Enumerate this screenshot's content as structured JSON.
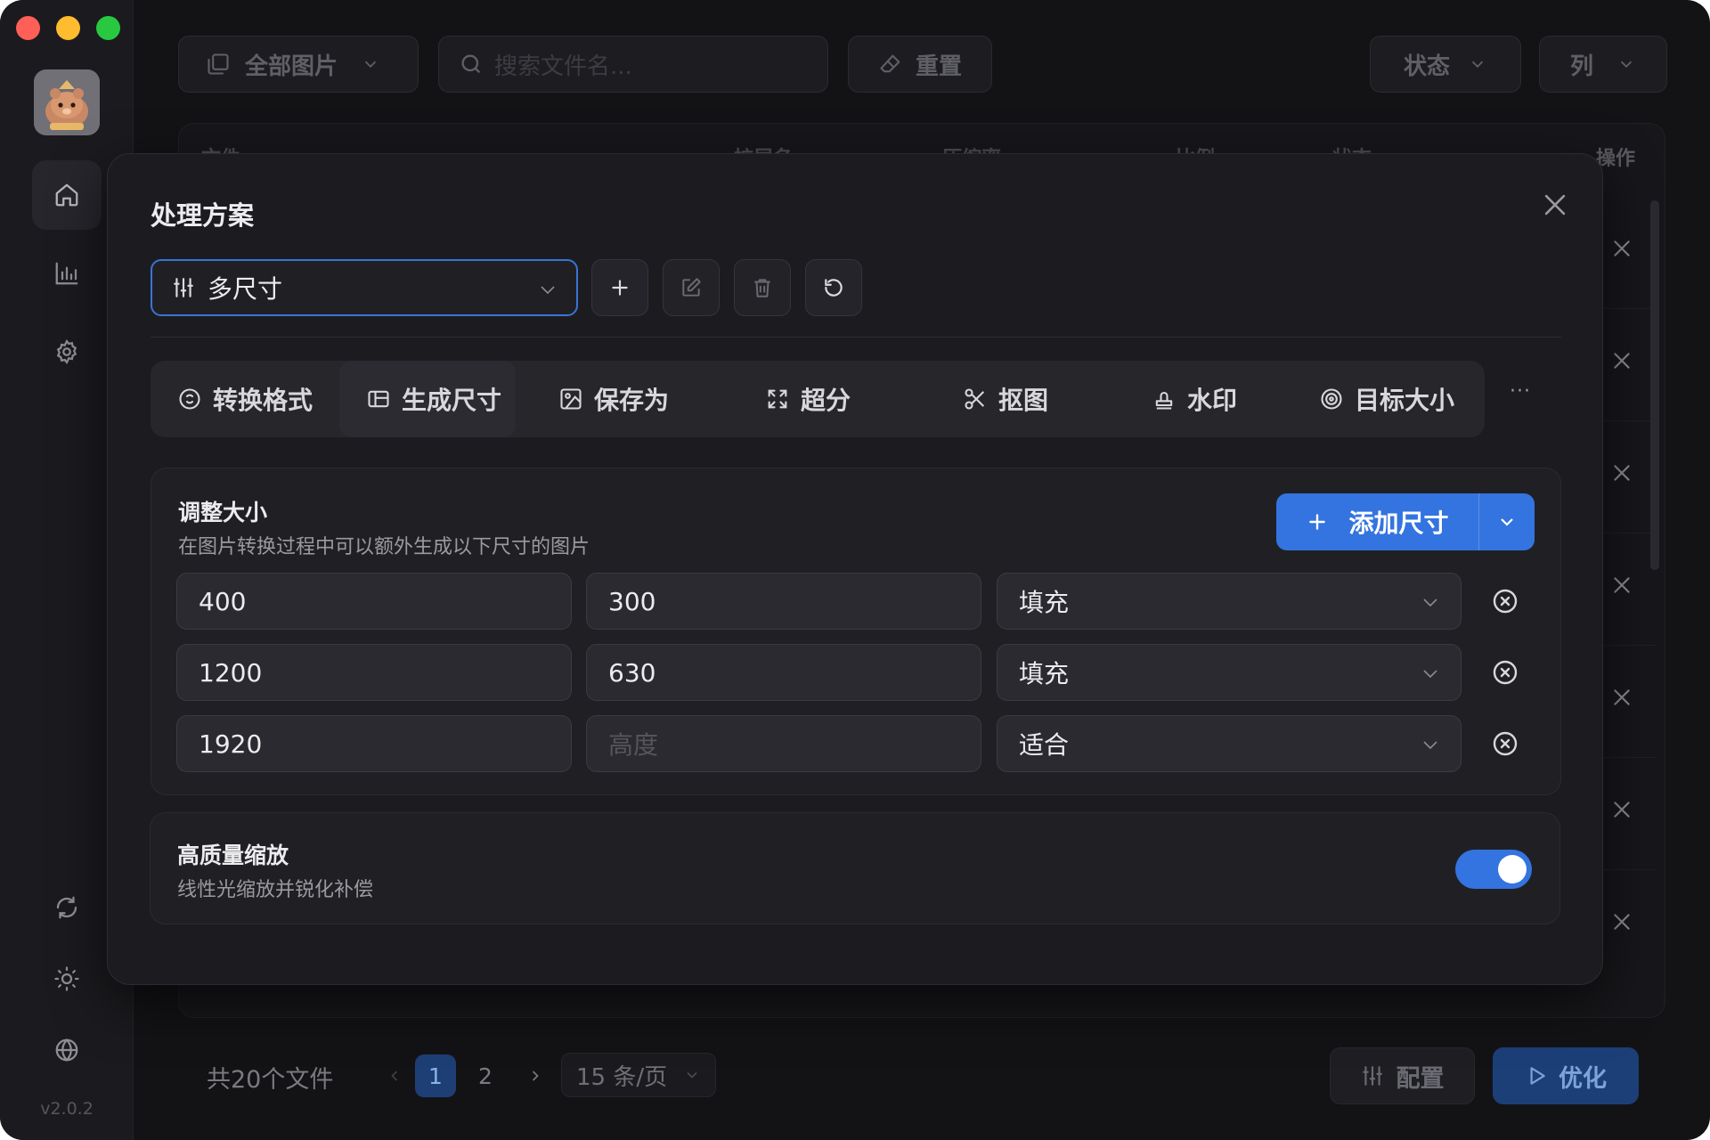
{
  "toolbar": {
    "filter_label": "全部图片",
    "search_placeholder": "搜索文件名...",
    "reset_label": "重置",
    "status_label": "状态",
    "columns_label": "列"
  },
  "table": {
    "headers": [
      "文件",
      "扩展名",
      "压缩率",
      "比例",
      "状态",
      "操作"
    ]
  },
  "sidebar": {
    "version": "v2.0.2"
  },
  "footer": {
    "total": "共20个文件",
    "pages": [
      "1",
      "2"
    ],
    "current_page": "1",
    "per_page": "15 条/页",
    "config_label": "配置",
    "optimize_label": "优化"
  },
  "modal": {
    "title": "处理方案",
    "scheme": "多尺寸",
    "tabs": [
      "转换格式",
      "生成尺寸",
      "保存为",
      "超分",
      "抠图",
      "水印",
      "目标大小"
    ],
    "more_label": "···",
    "resize": {
      "title": "调整大小",
      "desc": "在图片转换过程中可以额外生成以下尺寸的图片",
      "add_label": "添加尺寸",
      "rows": [
        {
          "width": "400",
          "height": "300",
          "mode": "填充"
        },
        {
          "width": "1200",
          "height": "630",
          "mode": "填充"
        },
        {
          "width": "1920",
          "height": "",
          "height_placeholder": "高度",
          "mode": "适合"
        }
      ]
    },
    "hq": {
      "title": "高质量缩放",
      "desc": "线性光缩放并锐化补偿",
      "enabled": true
    }
  },
  "colors": {
    "accent": "#3474e0",
    "window_bg": "#131316",
    "modal_bg": "#1c1c20"
  }
}
